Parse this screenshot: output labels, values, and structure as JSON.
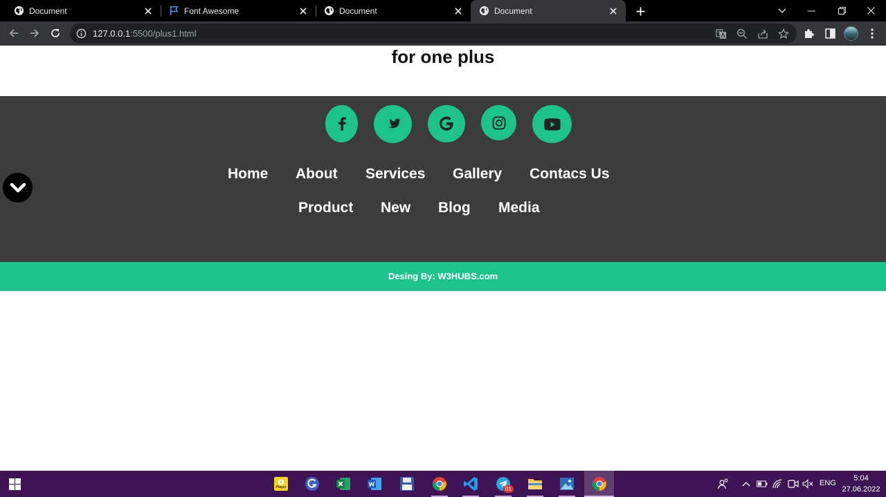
{
  "browser": {
    "tabs": [
      {
        "title": "Document",
        "favicon": "globe-icon",
        "active": false
      },
      {
        "title": "Font Awesome",
        "favicon": "flag-icon",
        "active": false
      },
      {
        "title": "Document",
        "favicon": "globe-icon",
        "active": false
      },
      {
        "title": "Document",
        "favicon": "globe-icon",
        "active": true
      }
    ],
    "address": {
      "host": "127.0.0.1",
      "path": ":5500/plus1.html"
    }
  },
  "page": {
    "heading": "for one plus",
    "social_icons": [
      "facebook-icon",
      "twitter-icon",
      "google-icon",
      "instagram-icon",
      "youtube-icon"
    ],
    "nav_row1": [
      "Home",
      "About",
      "Services",
      "Gallery",
      "Contacs Us"
    ],
    "nav_row2": [
      "Product",
      "New",
      "Blog",
      "Media"
    ],
    "credit": "Desing By: W3HUBS.com",
    "colors": {
      "accent": "#1cc38b",
      "footer_bg": "#3c3c3c",
      "icon": "#222222"
    }
  },
  "taskbar": {
    "apps": [
      "kmplayer-icon",
      "grammarly-icon",
      "excel-icon",
      "word-icon",
      "save-icon",
      "chrome-icon",
      "vscode-icon",
      "telegram-icon",
      "file-explorer-icon",
      "photos-icon",
      "chrome-icon"
    ],
    "telegram_badge": "01",
    "kmplayer_label": "Player",
    "language": "ENG",
    "time": "5:04",
    "date": "27.06.2022"
  }
}
